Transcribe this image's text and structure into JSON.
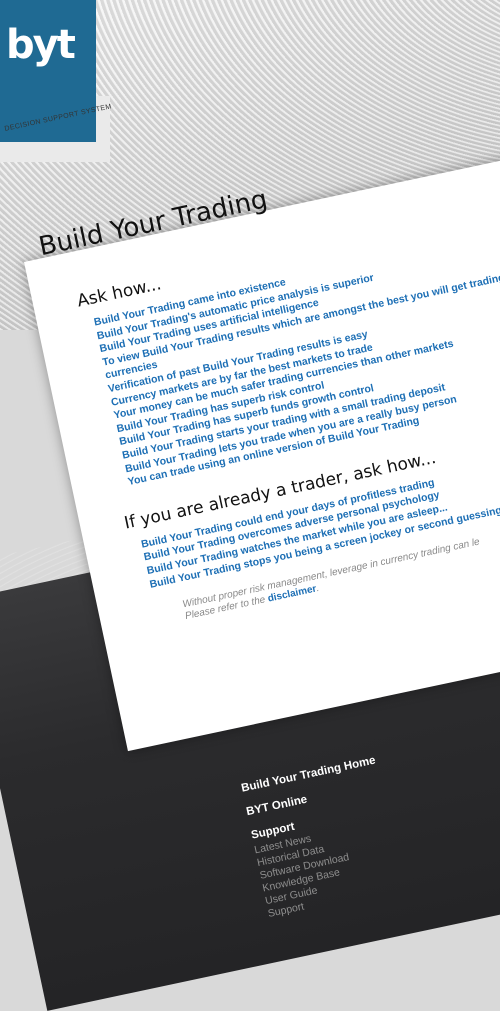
{
  "logo": {
    "mark": "byt",
    "tagline": "DECISION SUPPORT SYSTEM"
  },
  "page": {
    "title": "Build Your Trading"
  },
  "ask_section": {
    "heading": "Ask how...",
    "items": [
      "Build Your Trading came into existence",
      "Build Your Trading's automatic price analysis is superior",
      "Build Your Trading uses artificial intelligence",
      "To view Build Your Trading results which are amongst the best you will get trading currencies",
      "Verification of past Build Your Trading results is easy",
      "Currency markets are by far the best markets to trade",
      "Your money can be much safer trading currencies than other markets",
      "Build Your Trading has superb risk control",
      "Build Your Trading has superb funds growth control",
      "Build Your Trading starts your trading with a small trading deposit",
      "Build Your Trading lets you trade when you are a really busy person",
      "You can trade using an online version of Build Your Trading"
    ]
  },
  "trader_section": {
    "heading": "If you are already a trader, ask how...",
    "items": [
      "Build Your Trading could end your days of profitless trading",
      "Build Your Trading overcomes adverse personal psychology",
      "Build Your Trading watches the market while you are asleep...",
      "Build Your Trading stops you being a screen jockey or second guessing"
    ]
  },
  "disclaimer": {
    "line1": "Without proper risk management, leverage in currency trading can le",
    "line2_prefix": "Please refer to the ",
    "link": "disclaimer",
    "line2_suffix": "."
  },
  "footer_nav": {
    "home": "Build Your Trading Home",
    "online": "BYT Online",
    "support": "Support",
    "support_items": [
      "Latest News",
      "Historical Data",
      "Software Download",
      "Knowledge Base",
      "User Guide",
      "Support"
    ]
  }
}
